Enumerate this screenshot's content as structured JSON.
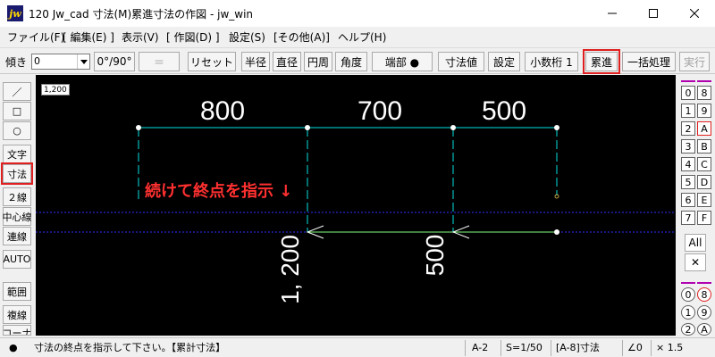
{
  "window": {
    "app_icon_text": "jw",
    "title": "120 Jw_cad 寸法(M)累進寸法の作図 - jw_win"
  },
  "menu": [
    "ファイル(F)",
    "[ 編集(E) ]",
    "表示(V)",
    "[ 作図(D) ]",
    "設定(S)",
    "[その他(A)]",
    "ヘルプ(H)"
  ],
  "toolbar": {
    "tilt_label": "傾き",
    "tilt_value": "0",
    "angle_toggle": "0°/90°",
    "equals_button": "＝",
    "reset_button": "リセット",
    "radius_button": "半径",
    "diameter_button": "直径",
    "circumference_button": "円周",
    "angle_button": "角度",
    "endpoint_button": "端部 ●",
    "dim_value_button": "寸法値",
    "settings_button": "設定",
    "decimal_button": "小数桁 1",
    "cumulative_button": "累進",
    "batch_button": "一括処理",
    "execute_button": "実行"
  },
  "left_tools": [
    {
      "name": "line-tool",
      "label": "／"
    },
    {
      "name": "rectangle-tool",
      "label": "□"
    },
    {
      "name": "circle-tool",
      "label": "○"
    },
    {
      "name": "text-tool",
      "label": "文字"
    },
    {
      "name": "dimension-tool",
      "label": "寸法"
    },
    {
      "name": "double-line-tool",
      "label": "２線"
    },
    {
      "name": "centerline-tool",
      "label": "中心線"
    },
    {
      "name": "continuous-line-tool",
      "label": "連線"
    },
    {
      "name": "auto-tool",
      "label": "AUTO"
    },
    {
      "name": "range-tool",
      "label": "範囲"
    },
    {
      "name": "copy-line-tool",
      "label": "複線"
    },
    {
      "name": "corner-tool",
      "label": "コーナ"
    }
  ],
  "canvas": {
    "scale_badge": "1,200",
    "instruction": "続けて終点を指示 ↓",
    "dimensions_top": [
      "800",
      "700",
      "500"
    ],
    "dimensions_vertical": [
      "1, 200",
      "500"
    ],
    "colors": {
      "background": "#000000",
      "dim_line": "#00e0e0",
      "dim_text": "#ffffff",
      "instruction": "#ff3030",
      "guide": "#3030ff",
      "active_line": "#80ff80"
    }
  },
  "right_panel": {
    "layer_left": [
      "0",
      "1",
      "2",
      "3",
      "4",
      "5",
      "6",
      "7"
    ],
    "layer_right": [
      "8",
      "9",
      "A",
      "B",
      "C",
      "D",
      "E",
      "F"
    ],
    "all_button": "All",
    "close_button": "✕",
    "group_left": [
      "0",
      "1",
      "2"
    ],
    "group_right": [
      "8",
      "9",
      "A"
    ]
  },
  "status": {
    "message": "寸法の終点を指示して下さい。【累計寸法】",
    "paper": "A-2",
    "scale": "S=1/50",
    "layer": "[A-8]寸法",
    "angle": "∠0",
    "zoom": "× 1.5"
  }
}
